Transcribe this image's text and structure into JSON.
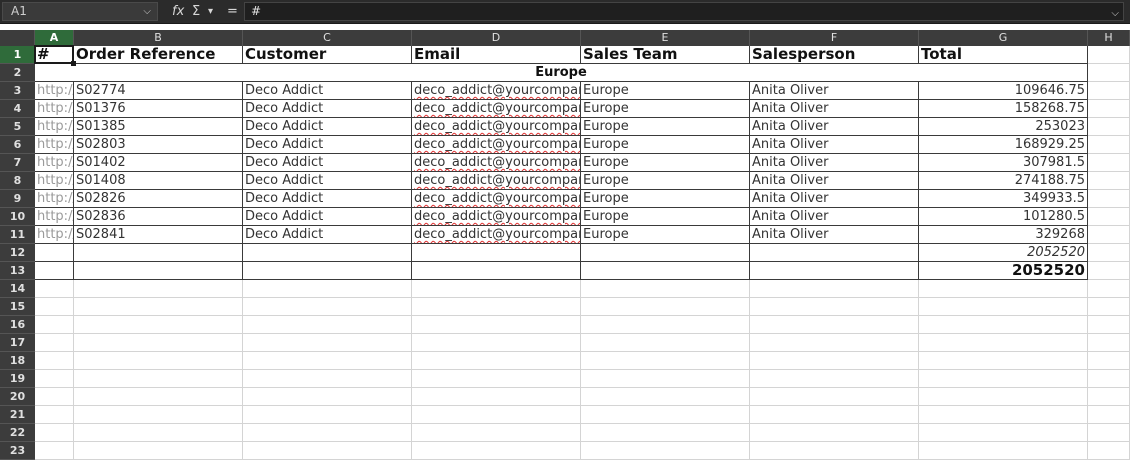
{
  "formula_bar": {
    "name_box": "A1",
    "name_box_arrow": "⌵",
    "function_wizard_icon": "fx",
    "sum_icon": "Σ",
    "sum_dropdown": "▾",
    "equals_icon": "=",
    "formula": "#",
    "expand": "⌵"
  },
  "columns": [
    "A",
    "B",
    "C",
    "D",
    "E",
    "F",
    "G",
    "H"
  ],
  "active_column": "A",
  "active_row": 1,
  "rows": [
    "1",
    "2",
    "3",
    "4",
    "5",
    "6",
    "7",
    "8",
    "9",
    "10",
    "11",
    "12",
    "13",
    "14",
    "15",
    "16",
    "17",
    "18",
    "19",
    "20",
    "21",
    "22",
    "23"
  ],
  "sheet": {
    "headers": [
      "#",
      "Order Reference",
      "Customer",
      "Email",
      "Sales Team",
      "Salesperson",
      "Total"
    ],
    "group_label": "Europe",
    "orders": [
      {
        "link": "http://",
        "ref": "S02774",
        "customer": "Deco Addict",
        "email": "deco_addict@yourcompany.example.com",
        "team": "Europe",
        "salesperson": "Anita Oliver",
        "total": "109646.75"
      },
      {
        "link": "http://",
        "ref": "S01376",
        "customer": "Deco Addict",
        "email": "deco_addict@yourcompany.example.com",
        "team": "Europe",
        "salesperson": "Anita Oliver",
        "total": "158268.75"
      },
      {
        "link": "http://",
        "ref": "S01385",
        "customer": "Deco Addict",
        "email": "deco_addict@yourcompany.example.com",
        "team": "Europe",
        "salesperson": "Anita Oliver",
        "total": "253023"
      },
      {
        "link": "http://",
        "ref": "S02803",
        "customer": "Deco Addict",
        "email": "deco_addict@yourcompany.example.com",
        "team": "Europe",
        "salesperson": "Anita Oliver",
        "total": "168929.25"
      },
      {
        "link": "http://",
        "ref": "S01402",
        "customer": "Deco Addict",
        "email": "deco_addict@yourcompany.example.com",
        "team": "Europe",
        "salesperson": "Anita Oliver",
        "total": "307981.5"
      },
      {
        "link": "http://",
        "ref": "S01408",
        "customer": "Deco Addict",
        "email": "deco_addict@yourcompany.example.com",
        "team": "Europe",
        "salesperson": "Anita Oliver",
        "total": "274188.75"
      },
      {
        "link": "http://",
        "ref": "S02826",
        "customer": "Deco Addict",
        "email": "deco_addict@yourcompany.example.com",
        "team": "Europe",
        "salesperson": "Anita Oliver",
        "total": "349933.5"
      },
      {
        "link": "http://",
        "ref": "S02836",
        "customer": "Deco Addict",
        "email": "deco_addict@yourcompany.example.com",
        "team": "Europe",
        "salesperson": "Anita Oliver",
        "total": "101280.5"
      },
      {
        "link": "http://",
        "ref": "S02841",
        "customer": "Deco Addict",
        "email": "deco_addict@yourcompany.example.com",
        "team": "Europe",
        "salesperson": "Anita Oliver",
        "total": "329268"
      }
    ],
    "subtotal": "2052520",
    "grand_total": "2052520"
  }
}
